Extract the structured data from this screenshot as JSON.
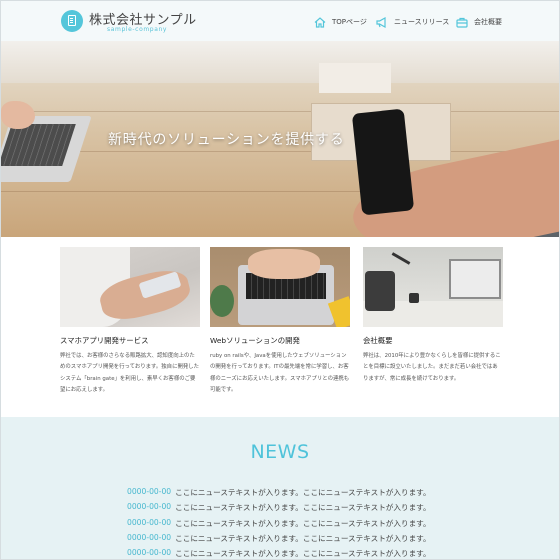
{
  "header": {
    "logo_title": "株式会社サンプル",
    "logo_subtitle": "sample-company",
    "nav": [
      {
        "label": "TOPページ",
        "icon": "home-icon"
      },
      {
        "label": "ニュースリリース",
        "icon": "megaphone-icon"
      },
      {
        "label": "会社概要",
        "icon": "briefcase-icon"
      }
    ]
  },
  "hero": {
    "headline": "新時代のソリューションを提供する"
  },
  "services": [
    {
      "title": "スマホアプリ開発サービス",
      "body": "弊社では、お客様のさらなる販路拡大、認知度向上のためのスマホアプリ開発を行っております。独自に開発したシステム「brain gate」を利用し、素早くお客様のご要望にお応えします。"
    },
    {
      "title": "Webソリューションの開発",
      "body": "ruby on railsや、Javaを使用したウェブソリューションの開発を行っております。ITの最先端を常に学習し、お客様のニーズにお応えいたします。スマホアプリとの連携も可能です。"
    },
    {
      "title": "会社概要",
      "body": "弊社は、2010年により豊かなくらしを皆様に提供することを目標に設立いたしました。まだまだ若い会社ではありますが、常に成長を続けております。"
    }
  ],
  "news": {
    "heading": "NEWS",
    "items": [
      {
        "date": "0000-00-00",
        "text": "ここにニューステキストが入ります。ここにニューステキストが入ります。"
      },
      {
        "date": "0000-00-00",
        "text": "ここにニューステキストが入ります。ここにニューステキストが入ります。"
      },
      {
        "date": "0000-00-00",
        "text": "ここにニューステキストが入ります。ここにニューステキストが入ります。"
      },
      {
        "date": "0000-00-00",
        "text": "ここにニューステキストが入ります。ここにニューステキストが入ります。"
      },
      {
        "date": "0000-00-00",
        "text": "ここにニューステキストが入ります。ここにニューステキストが入ります。"
      }
    ]
  },
  "colors": {
    "accent": "#54c6da",
    "header_bg": "#f4f9fa",
    "news_bg": "#e6f2f4"
  }
}
